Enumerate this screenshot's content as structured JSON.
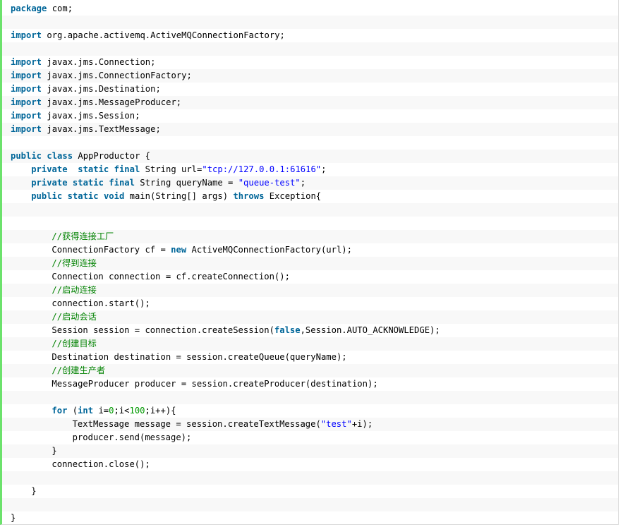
{
  "lines": [
    {
      "indent": 0,
      "tokens": [
        {
          "c": "kw",
          "t": "package"
        },
        {
          "c": "",
          "t": " com;"
        }
      ]
    },
    {
      "indent": 0,
      "tokens": []
    },
    {
      "indent": 0,
      "tokens": [
        {
          "c": "kw",
          "t": "import"
        },
        {
          "c": "",
          "t": " org.apache.activemq.ActiveMQConnectionFactory;"
        }
      ]
    },
    {
      "indent": 0,
      "tokens": []
    },
    {
      "indent": 0,
      "tokens": [
        {
          "c": "kw",
          "t": "import"
        },
        {
          "c": "",
          "t": " javax.jms.Connection;"
        }
      ]
    },
    {
      "indent": 0,
      "tokens": [
        {
          "c": "kw",
          "t": "import"
        },
        {
          "c": "",
          "t": " javax.jms.ConnectionFactory;"
        }
      ]
    },
    {
      "indent": 0,
      "tokens": [
        {
          "c": "kw",
          "t": "import"
        },
        {
          "c": "",
          "t": " javax.jms.Destination;"
        }
      ]
    },
    {
      "indent": 0,
      "tokens": [
        {
          "c": "kw",
          "t": "import"
        },
        {
          "c": "",
          "t": " javax.jms.MessageProducer;"
        }
      ]
    },
    {
      "indent": 0,
      "tokens": [
        {
          "c": "kw",
          "t": "import"
        },
        {
          "c": "",
          "t": " javax.jms.Session;"
        }
      ]
    },
    {
      "indent": 0,
      "tokens": [
        {
          "c": "kw",
          "t": "import"
        },
        {
          "c": "",
          "t": " javax.jms.TextMessage;"
        }
      ]
    },
    {
      "indent": 0,
      "tokens": []
    },
    {
      "indent": 0,
      "tokens": [
        {
          "c": "kw",
          "t": "public"
        },
        {
          "c": "",
          "t": " "
        },
        {
          "c": "kw",
          "t": "class"
        },
        {
          "c": "",
          "t": " AppProductor {"
        }
      ]
    },
    {
      "indent": 1,
      "tokens": [
        {
          "c": "kw",
          "t": "private"
        },
        {
          "c": "",
          "t": "  "
        },
        {
          "c": "kw",
          "t": "static"
        },
        {
          "c": "",
          "t": " "
        },
        {
          "c": "kw",
          "t": "final"
        },
        {
          "c": "",
          "t": " String url="
        },
        {
          "c": "str",
          "t": "\"tcp://127.0.0.1:61616\""
        },
        {
          "c": "",
          "t": ";"
        }
      ]
    },
    {
      "indent": 1,
      "tokens": [
        {
          "c": "kw",
          "t": "private"
        },
        {
          "c": "",
          "t": " "
        },
        {
          "c": "kw",
          "t": "static"
        },
        {
          "c": "",
          "t": " "
        },
        {
          "c": "kw",
          "t": "final"
        },
        {
          "c": "",
          "t": " String queryName = "
        },
        {
          "c": "str",
          "t": "\"queue-test\""
        },
        {
          "c": "",
          "t": ";"
        }
      ]
    },
    {
      "indent": 1,
      "tokens": [
        {
          "c": "kw",
          "t": "public"
        },
        {
          "c": "",
          "t": " "
        },
        {
          "c": "kw",
          "t": "static"
        },
        {
          "c": "",
          "t": " "
        },
        {
          "c": "kw",
          "t": "void"
        },
        {
          "c": "",
          "t": " main(String[] args) "
        },
        {
          "c": "kw",
          "t": "throws"
        },
        {
          "c": "",
          "t": " Exception{"
        }
      ]
    },
    {
      "indent": 0,
      "tokens": []
    },
    {
      "indent": 0,
      "tokens": []
    },
    {
      "indent": 2,
      "tokens": [
        {
          "c": "cmt",
          "t": "//获得连接工厂"
        }
      ]
    },
    {
      "indent": 2,
      "tokens": [
        {
          "c": "",
          "t": "ConnectionFactory cf = "
        },
        {
          "c": "kw",
          "t": "new"
        },
        {
          "c": "",
          "t": " ActiveMQConnectionFactory(url);"
        }
      ]
    },
    {
      "indent": 2,
      "tokens": [
        {
          "c": "cmt",
          "t": "//得到连接"
        }
      ]
    },
    {
      "indent": 2,
      "tokens": [
        {
          "c": "",
          "t": "Connection connection = cf.createConnection();"
        }
      ]
    },
    {
      "indent": 2,
      "tokens": [
        {
          "c": "cmt",
          "t": "//启动连接"
        }
      ]
    },
    {
      "indent": 2,
      "tokens": [
        {
          "c": "",
          "t": "connection.start();"
        }
      ]
    },
    {
      "indent": 2,
      "tokens": [
        {
          "c": "cmt",
          "t": "//启动会话"
        }
      ]
    },
    {
      "indent": 2,
      "tokens": [
        {
          "c": "",
          "t": "Session session = connection.createSession("
        },
        {
          "c": "kw",
          "t": "false"
        },
        {
          "c": "",
          "t": ",Session.AUTO_ACKNOWLEDGE);"
        }
      ]
    },
    {
      "indent": 2,
      "tokens": [
        {
          "c": "cmt",
          "t": "//创建目标"
        }
      ]
    },
    {
      "indent": 2,
      "tokens": [
        {
          "c": "",
          "t": "Destination destination = session.createQueue(queryName);"
        }
      ]
    },
    {
      "indent": 2,
      "tokens": [
        {
          "c": "cmt",
          "t": "//创建生产者"
        }
      ]
    },
    {
      "indent": 2,
      "tokens": [
        {
          "c": "",
          "t": "MessageProducer producer = session.createProducer(destination);"
        }
      ]
    },
    {
      "indent": 0,
      "tokens": []
    },
    {
      "indent": 2,
      "tokens": [
        {
          "c": "kw",
          "t": "for"
        },
        {
          "c": "",
          "t": " ("
        },
        {
          "c": "kw",
          "t": "int"
        },
        {
          "c": "",
          "t": " i="
        },
        {
          "c": "num",
          "t": "0"
        },
        {
          "c": "",
          "t": ";i<"
        },
        {
          "c": "num",
          "t": "100"
        },
        {
          "c": "",
          "t": ";i++){"
        }
      ]
    },
    {
      "indent": 3,
      "tokens": [
        {
          "c": "",
          "t": "TextMessage message = session.createTextMessage("
        },
        {
          "c": "str",
          "t": "\"test\""
        },
        {
          "c": "",
          "t": "+i);"
        }
      ]
    },
    {
      "indent": 3,
      "tokens": [
        {
          "c": "",
          "t": "producer.send(message);"
        }
      ]
    },
    {
      "indent": 2,
      "tokens": [
        {
          "c": "",
          "t": "}"
        }
      ]
    },
    {
      "indent": 2,
      "tokens": [
        {
          "c": "",
          "t": "connection.close();"
        }
      ]
    },
    {
      "indent": 0,
      "tokens": []
    },
    {
      "indent": 1,
      "tokens": [
        {
          "c": "",
          "t": "}"
        }
      ]
    },
    {
      "indent": 0,
      "tokens": []
    },
    {
      "indent": 0,
      "tokens": [
        {
          "c": "",
          "t": "}"
        }
      ]
    }
  ]
}
